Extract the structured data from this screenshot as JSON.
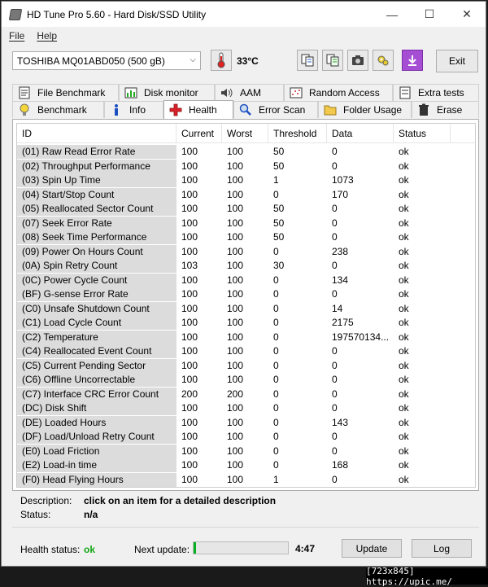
{
  "window": {
    "title": "HD Tune Pro 5.60 - Hard Disk/SSD Utility",
    "controls": {
      "minimize": "—",
      "maximize": "☐",
      "close": "✕"
    }
  },
  "menu": {
    "file": "File",
    "help": "Help"
  },
  "toolbar": {
    "drive": "TOSHIBA MQ01ABD050 (500 gB)",
    "temperature": "33°C",
    "exit": "Exit",
    "icons": [
      "copy-icon",
      "copy-all-icon",
      "camera-icon",
      "settings-icon",
      "download-icon"
    ]
  },
  "tabs": {
    "top": [
      {
        "label": "File Benchmark",
        "icon": "file-benchmark-icon"
      },
      {
        "label": "Disk monitor",
        "icon": "disk-monitor-icon"
      },
      {
        "label": "AAM",
        "icon": "speaker-icon"
      },
      {
        "label": "Random Access",
        "icon": "random-access-icon"
      },
      {
        "label": "Extra tests",
        "icon": "extra-tests-icon"
      }
    ],
    "bottom": [
      {
        "label": "Benchmark",
        "icon": "bulb-icon"
      },
      {
        "label": "Info",
        "icon": "info-icon"
      },
      {
        "label": "Health",
        "icon": "health-cross-icon",
        "active": true
      },
      {
        "label": "Error Scan",
        "icon": "magnifier-icon"
      },
      {
        "label": "Folder Usage",
        "icon": "folder-icon"
      },
      {
        "label": "Erase",
        "icon": "trash-icon"
      }
    ]
  },
  "table": {
    "columns": [
      "ID",
      "Current",
      "Worst",
      "Threshold",
      "Data",
      "Status"
    ],
    "rows": [
      [
        "(01) Raw Read Error Rate",
        "100",
        "100",
        "50",
        "0",
        "ok"
      ],
      [
        "(02) Throughput Performance",
        "100",
        "100",
        "50",
        "0",
        "ok"
      ],
      [
        "(03) Spin Up Time",
        "100",
        "100",
        "1",
        "1073",
        "ok"
      ],
      [
        "(04) Start/Stop Count",
        "100",
        "100",
        "0",
        "170",
        "ok"
      ],
      [
        "(05) Reallocated Sector Count",
        "100",
        "100",
        "50",
        "0",
        "ok"
      ],
      [
        "(07) Seek Error Rate",
        "100",
        "100",
        "50",
        "0",
        "ok"
      ],
      [
        "(08) Seek Time Performance",
        "100",
        "100",
        "50",
        "0",
        "ok"
      ],
      [
        "(09) Power On Hours Count",
        "100",
        "100",
        "0",
        "238",
        "ok"
      ],
      [
        "(0A) Spin Retry Count",
        "103",
        "100",
        "30",
        "0",
        "ok"
      ],
      [
        "(0C) Power Cycle Count",
        "100",
        "100",
        "0",
        "134",
        "ok"
      ],
      [
        "(BF) G-sense Error Rate",
        "100",
        "100",
        "0",
        "0",
        "ok"
      ],
      [
        "(C0) Unsafe Shutdown Count",
        "100",
        "100",
        "0",
        "14",
        "ok"
      ],
      [
        "(C1) Load Cycle Count",
        "100",
        "100",
        "0",
        "2175",
        "ok"
      ],
      [
        "(C2) Temperature",
        "100",
        "100",
        "0",
        "197570134...",
        "ok"
      ],
      [
        "(C4) Reallocated Event Count",
        "100",
        "100",
        "0",
        "0",
        "ok"
      ],
      [
        "(C5) Current Pending Sector",
        "100",
        "100",
        "0",
        "0",
        "ok"
      ],
      [
        "(C6) Offline Uncorrectable",
        "100",
        "100",
        "0",
        "0",
        "ok"
      ],
      [
        "(C7) Interface CRC Error Count",
        "200",
        "200",
        "0",
        "0",
        "ok"
      ],
      [
        "(DC) Disk Shift",
        "100",
        "100",
        "0",
        "0",
        "ok"
      ],
      [
        "(DE) Loaded Hours",
        "100",
        "100",
        "0",
        "143",
        "ok"
      ],
      [
        "(DF) Load/Unload Retry Count",
        "100",
        "100",
        "0",
        "0",
        "ok"
      ],
      [
        "(E0) Load Friction",
        "100",
        "100",
        "0",
        "0",
        "ok"
      ],
      [
        "(E2) Load-in time",
        "100",
        "100",
        "0",
        "168",
        "ok"
      ],
      [
        "(F0) Head Flying Hours",
        "100",
        "100",
        "1",
        "0",
        "ok"
      ]
    ]
  },
  "details": {
    "description_label": "Description:",
    "description_value": "click on an item for a detailed description",
    "status_label": "Status:",
    "status_value": "n/a"
  },
  "footer": {
    "health_label": "Health status:",
    "health_value": "ok",
    "next_update_label": "Next update:",
    "next_update_progress": 0.03,
    "next_update_time": "4:47",
    "update_button": "Update",
    "log_button": "Log"
  },
  "watermark": "[723x845] https://upic.me/",
  "colors": {
    "health_ok": "#14a614",
    "progress": "#06b025"
  }
}
